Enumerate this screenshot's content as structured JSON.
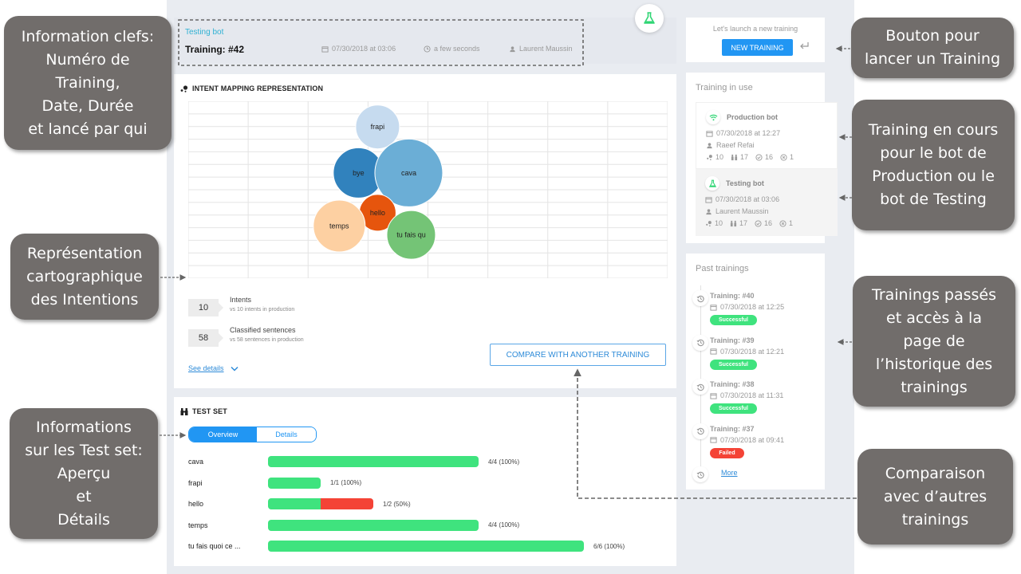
{
  "header": {
    "bot_name": "Testing bot",
    "training_number": "Training: #42",
    "date": "07/30/2018 at 03:06",
    "duration": "a few seconds",
    "launched_by": "Laurent Maussin"
  },
  "intent_mapping": {
    "title": "INTENT MAPPING REPRESENTATION",
    "stats": [
      {
        "value": "10",
        "label": "Intents",
        "sub": "vs 10 intents in production"
      },
      {
        "value": "58",
        "label": "Classified sentences",
        "sub": "vs 58 sentences in production"
      }
    ],
    "see_details": "See details",
    "compare_button": "COMPARE WITH ANOTHER TRAINING"
  },
  "chart_data": [
    {
      "type": "scatter",
      "title": "INTENT MAPPING REPRESENTATION",
      "subtype": "bubble",
      "grid": true,
      "grid_columns": 8,
      "grid_rows": 14,
      "bubbles": [
        {
          "label": "frapi",
          "cx": 0.395,
          "cy": 0.145,
          "r": 0.55,
          "color": "#c6dbef"
        },
        {
          "label": "bye",
          "cx": 0.355,
          "cy": 0.405,
          "r": 0.63,
          "color": "#3182bd"
        },
        {
          "label": "cava",
          "cx": 0.46,
          "cy": 0.405,
          "r": 0.85,
          "color": "#6baed6"
        },
        {
          "label": "hello",
          "cx": 0.395,
          "cy": 0.63,
          "r": 0.46,
          "color": "#e6550d"
        },
        {
          "label": "temps",
          "cx": 0.315,
          "cy": 0.705,
          "r": 0.65,
          "color": "#fdd0a2"
        },
        {
          "label": "tu fais qu",
          "cx": 0.465,
          "cy": 0.755,
          "r": 0.61,
          "color": "#74c476"
        }
      ]
    },
    {
      "type": "bar",
      "title": "TEST SET",
      "orientation": "horizontal",
      "categories": [
        "cava",
        "frapi",
        "hello",
        "temps",
        "tu fais quoi ce ..."
      ],
      "series": [
        {
          "name": "correct",
          "values": [
            4,
            1,
            1,
            4,
            6
          ],
          "color": "#3fe37e"
        },
        {
          "name": "incorrect",
          "values": [
            0,
            0,
            1,
            0,
            0
          ],
          "color": "#f44336"
        }
      ],
      "labels": [
        "4/4 (100%)",
        "1/1 (100%)",
        "1/2 (50%)",
        "4/4 (100%)",
        "6/6 (100%)"
      ],
      "xlim": [
        0,
        6
      ]
    }
  ],
  "test_set": {
    "title": "TEST SET",
    "tabs": [
      {
        "label": "Overview",
        "active": true
      },
      {
        "label": "Details",
        "active": false
      }
    ]
  },
  "launch": {
    "hint": "Let's launch a new training",
    "button": "NEW TRAINING"
  },
  "training_in_use": {
    "title": "Training in use",
    "bots": [
      {
        "name": "Production bot",
        "icon": "wifi-icon",
        "date": "07/30/2018 at 12:27",
        "user": "Raeef Refai",
        "intents": "10",
        "sentences": "17",
        "successes": "16",
        "failures": "1"
      },
      {
        "name": "Testing bot",
        "icon": "flask-icon",
        "date": "07/30/2018 at 03:06",
        "user": "Laurent Maussin",
        "intents": "10",
        "sentences": "17",
        "successes": "16",
        "failures": "1"
      }
    ]
  },
  "past_trainings": {
    "title": "Past trainings",
    "items": [
      {
        "title": "Training: #40",
        "date": "07/30/2018 at 12:25",
        "status": "Successful"
      },
      {
        "title": "Training: #39",
        "date": "07/30/2018 at 12:21",
        "status": "Successful"
      },
      {
        "title": "Training: #38",
        "date": "07/30/2018 at 11:31",
        "status": "Successful"
      },
      {
        "title": "Training: #37",
        "date": "07/30/2018 at 09:41",
        "status": "Failed"
      }
    ],
    "more": "More"
  },
  "annotations": {
    "key_info": "Information clefs:\nNuméro de\nTraining,\nDate, Durée\net lancé par qui",
    "intent_map": "Représentation\ncartographique\ndes Intentions",
    "test_set": "Informations\nsur les Test set:\nAperçu\net\nDétails",
    "launch": "Bouton pour\nlancer un Training",
    "in_use": "Training en cours\npour le  bot de\nProduction ou le\nbot de Testing",
    "past": "Trainings passés\net accès à la\npage de\nl’historique des\ntrainings",
    "compare": "Comparaison\navec d’autres\ntrainings"
  },
  "colors": {
    "primary": "#2196f3",
    "success": "#3fe37e",
    "danger": "#f44336",
    "bot_name": "#2fb1d3",
    "annotation_bg": "#716d6b"
  }
}
